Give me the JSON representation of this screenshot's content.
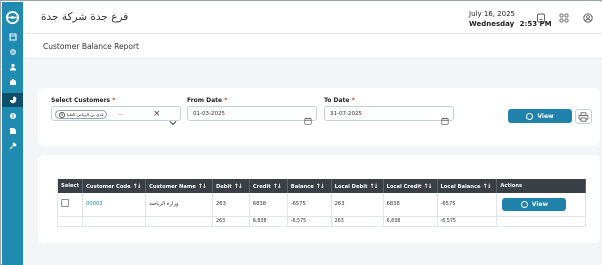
{
  "header": {
    "company": "فرع جدة  شركة جدة",
    "date": "July 16, 2025",
    "day": "Wednesday",
    "time": "2:53 PM",
    "icons": [
      "tablet-icon",
      "apps-grid-icon",
      "user-profile-icon"
    ]
  },
  "sidebar": {
    "logo": "app-logo-icon",
    "items": [
      "dashboard-icon",
      "settings-icon",
      "users-icon",
      "inventory-icon",
      "reports-icon",
      "finance-icon",
      "catalog-icon",
      "tools-icon"
    ],
    "active_index": 4
  },
  "page": {
    "title": "Customer Balance Report"
  },
  "filters": {
    "customers_label": "Select Customers",
    "customers_chip": "عدي بن الرياض العليا",
    "customers_more": "...",
    "from_label": "From Date",
    "from_value": "01-03-2025",
    "to_label": "To Date",
    "to_value": "31-07-2025",
    "required_mark": "*",
    "view_label": "View"
  },
  "table": {
    "columns": [
      "Select",
      "Customer Code",
      "Customer Name",
      "Debit",
      "Credit",
      "Balance",
      "Local Debit",
      "Local Credit",
      "Local Balance",
      "Actions"
    ],
    "sort_glyph": "↑↓",
    "rows": [
      {
        "code": "00003",
        "name": "وزارة الرياضة",
        "debit": "263",
        "credit": "6838",
        "balance": "-6575",
        "local_debit": "263",
        "local_credit": "6838",
        "local_balance": "-6575",
        "action": "View"
      }
    ],
    "totals": {
      "debit": "263",
      "credit": "6,838",
      "balance": "-6,575",
      "local_debit": "263",
      "local_credit": "6,838",
      "local_balance": "-6,575"
    }
  },
  "colors": {
    "sidebar": "#1f8bb0",
    "sidebar_active": "#0f4f6a",
    "primary_button": "#2082ab",
    "table_header": "#3a3f45",
    "required": "#d0342c"
  }
}
